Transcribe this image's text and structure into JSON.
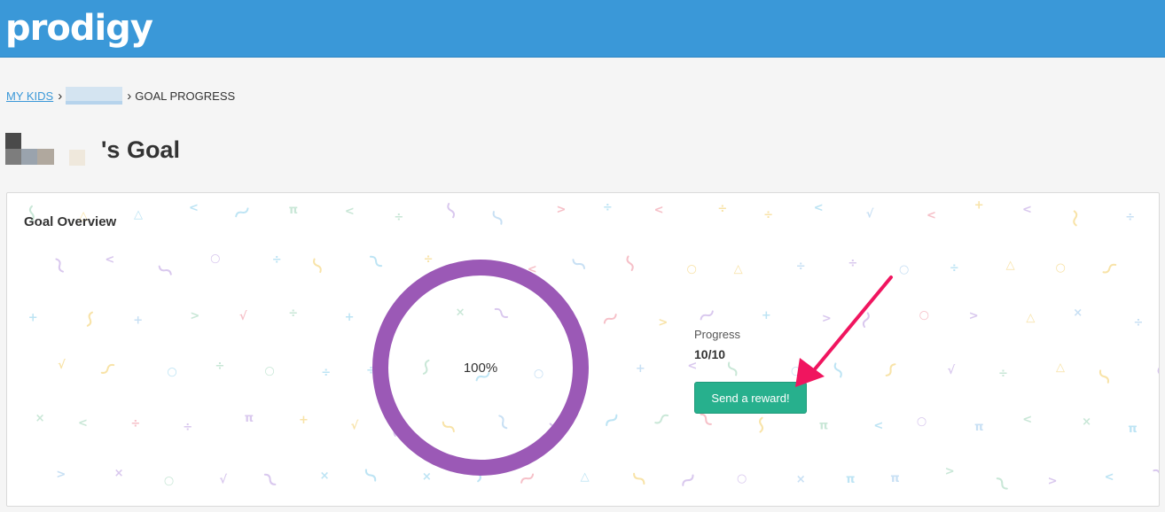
{
  "header": {
    "logo": "prodigy"
  },
  "breadcrumb": {
    "items": [
      {
        "label": "MY KIDS"
      },
      {
        "label": "GOAL PROGRESS"
      }
    ]
  },
  "page": {
    "title_suffix": "'s Goal"
  },
  "goal_overview": {
    "title": "Goal Overview",
    "percent_text": "100%",
    "progress_fraction": 1.0,
    "progress_label": "Progress",
    "progress_value": "10/10",
    "reward_button": "Send a reward!"
  },
  "colors": {
    "header": "#3a98d8",
    "ring": "#9b59b6",
    "button": "#27b08d",
    "annotation_arrow": "#f0155f"
  }
}
